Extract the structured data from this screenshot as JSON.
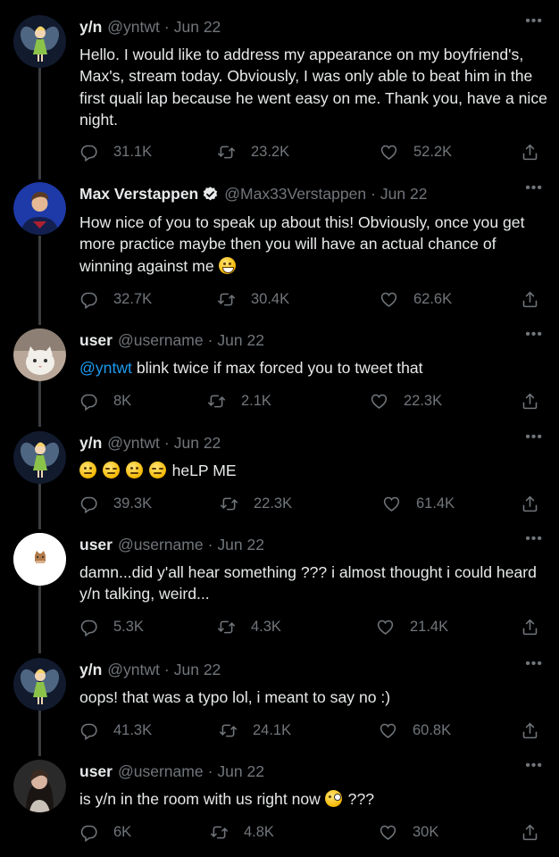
{
  "tweets": [
    {
      "name": "y/n",
      "handle": "@yntwt",
      "date": "Jun 22",
      "text": "Hello. I would like to address my appearance on my boyfriend's, Max's, stream today. Obviously, I was only able to beat him in the first quali lap because he went easy on me. Thank you, have a nice night.",
      "replies": "31.1K",
      "retweets": "23.2K",
      "likes": "52.2K",
      "avatar_icon": "fairy-avatar"
    },
    {
      "name": "Max Verstappen",
      "handle": "@Max33Verstappen",
      "date": "Jun 22",
      "verified": true,
      "text": "How nice of you to speak up about this! Obviously, once you get more practice maybe then you will have an actual chance of winning against me",
      "replies": "32.7K",
      "retweets": "30.4K",
      "likes": "62.6K",
      "avatar_icon": "driver-avatar"
    },
    {
      "name": "user",
      "handle": "@username",
      "date": "Jun 22",
      "mention": "@yntwt",
      "text": "blink twice if max forced you to tweet that",
      "replies": "8K",
      "retweets": "2.1K",
      "likes": "22.3K",
      "avatar_icon": "cat-avatar"
    },
    {
      "name": "y/n",
      "handle": "@yntwt",
      "date": "Jun 22",
      "text": "heLP ME",
      "replies": "39.3K",
      "retweets": "22.3K",
      "likes": "61.4K",
      "avatar_icon": "fairy-avatar"
    },
    {
      "name": "user",
      "handle": "@username",
      "date": "Jun 22",
      "text": "damn...did y'all hear something ??? i almost thought i could heard y/n talking, weird...",
      "replies": "5.3K",
      "retweets": "4.3K",
      "likes": "21.4K",
      "avatar_icon": "cat-sticker-avatar"
    },
    {
      "name": "y/n",
      "handle": "@yntwt",
      "date": "Jun 22",
      "text": "oops! that was a typo lol, i meant to say no :)",
      "replies": "41.3K",
      "retweets": "24.1K",
      "likes": "60.8K",
      "avatar_icon": "fairy-avatar"
    },
    {
      "name": "user",
      "handle": "@username",
      "date": "Jun 22",
      "text": "is y/n in the room with us right now",
      "text_after": "???",
      "replies": "6K",
      "retweets": "4.8K",
      "likes": "30K",
      "avatar_icon": "girl-avatar"
    }
  ],
  "more_icon": "more-options-icon",
  "colors": {
    "background": "#000000",
    "secondary": "#71767b",
    "mention": "#1d9bf0",
    "verified": "#e7e9ea"
  }
}
